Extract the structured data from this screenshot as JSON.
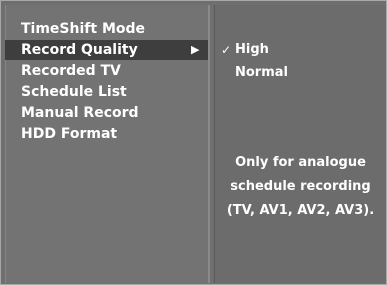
{
  "menu": {
    "items": [
      {
        "label": "TimeShift Mode"
      },
      {
        "label": "Record Quality"
      },
      {
        "label": "Recorded TV"
      },
      {
        "label": "Schedule List"
      },
      {
        "label": "Manual Record"
      },
      {
        "label": "HDD Format"
      }
    ],
    "selected_index": 1,
    "selected_arrow": "▶"
  },
  "submenu": {
    "options": [
      {
        "label": "High",
        "checked": true
      },
      {
        "label": "Normal",
        "checked": false
      }
    ],
    "check_mark": "✓",
    "note_lines": [
      "Only  for analogue",
      "schedule recording",
      "(TV, AV1, AV2, AV3)."
    ]
  }
}
